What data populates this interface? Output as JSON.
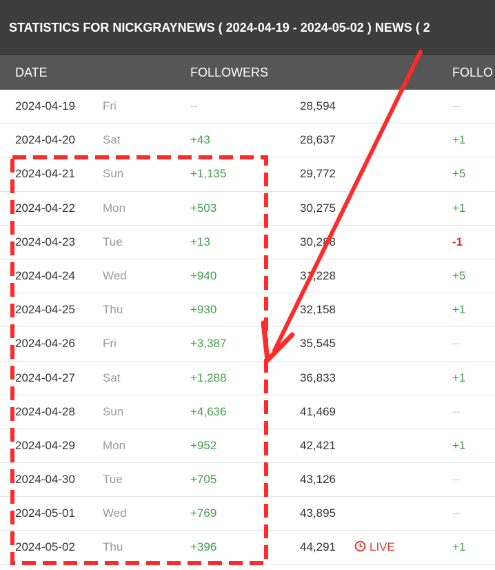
{
  "title": "STATISTICS FOR NICKGRAYNEWS ( 2024-04-19 - 2024-05-02 )  NEWS ( 2",
  "columns": {
    "date": "DATE",
    "followers": "FOLLOWERS",
    "news_followers": "FOLLO"
  },
  "rows": [
    {
      "date": "2024-04-19",
      "day": "Fri",
      "change": "--",
      "total": "28,594",
      "news_change": "--"
    },
    {
      "date": "2024-04-20",
      "day": "Sat",
      "change": "+43",
      "total": "28,637",
      "news_change": "+1"
    },
    {
      "date": "2024-04-21",
      "day": "Sun",
      "change": "+1,135",
      "total": "29,772",
      "news_change": "+5"
    },
    {
      "date": "2024-04-22",
      "day": "Mon",
      "change": "+503",
      "total": "30,275",
      "news_change": "+1"
    },
    {
      "date": "2024-04-23",
      "day": "Tue",
      "change": "+13",
      "total": "30,288",
      "news_change": "-1"
    },
    {
      "date": "2024-04-24",
      "day": "Wed",
      "change": "+940",
      "total": "31,228",
      "news_change": "+5"
    },
    {
      "date": "2024-04-25",
      "day": "Thu",
      "change": "+930",
      "total": "32,158",
      "news_change": "+1"
    },
    {
      "date": "2024-04-26",
      "day": "Fri",
      "change": "+3,387",
      "total": "35,545",
      "news_change": "--"
    },
    {
      "date": "2024-04-27",
      "day": "Sat",
      "change": "+1,288",
      "total": "36,833",
      "news_change": "+1"
    },
    {
      "date": "2024-04-28",
      "day": "Sun",
      "change": "+4,636",
      "total": "41,469",
      "news_change": "--"
    },
    {
      "date": "2024-04-29",
      "day": "Mon",
      "change": "+952",
      "total": "42,421",
      "news_change": "+1"
    },
    {
      "date": "2024-04-30",
      "day": "Tue",
      "change": "+705",
      "total": "43,126",
      "news_change": "--"
    },
    {
      "date": "2024-05-01",
      "day": "Wed",
      "change": "+769",
      "total": "43,895",
      "news_change": "--"
    },
    {
      "date": "2024-05-02",
      "day": "Thu",
      "change": "+396",
      "total": "44,291",
      "news_change": "+1",
      "live": "LIVE"
    }
  ],
  "icons": {
    "live_icon": "clock-icon"
  },
  "colors": {
    "positive": "#43a047",
    "negative": "#d32f2f",
    "live": "#e53935",
    "annotation": "#ff2a2a",
    "title_bg": "#3d3d3d",
    "header_bg": "#565656"
  }
}
